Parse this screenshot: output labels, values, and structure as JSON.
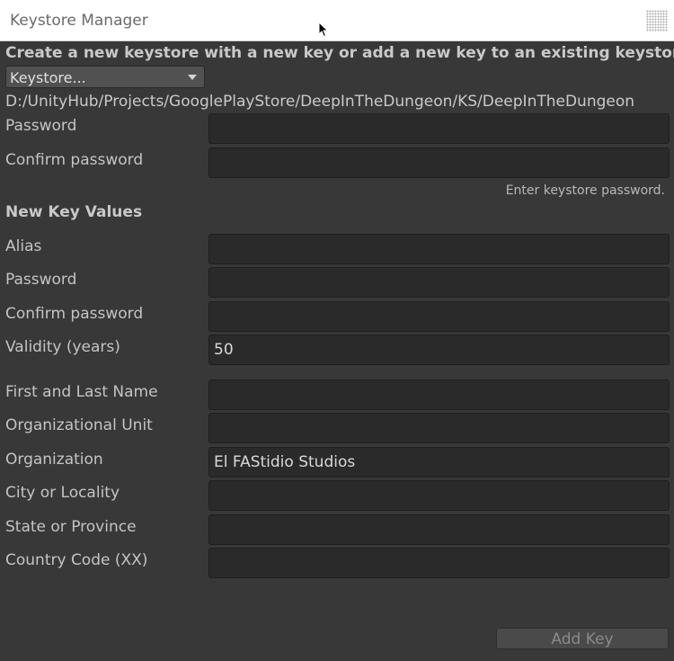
{
  "window": {
    "title": "Keystore Manager"
  },
  "heading": "Create a new keystore with a new key or add a new key to an existing keystore",
  "keystore_dropdown": {
    "selected": "Keystore..."
  },
  "keystore_path": "D:/UnityHub/Projects/GooglePlayStore/DeepInTheDungeon/KS/DeepInTheDungeon",
  "keystore": {
    "password_label": "Password",
    "password_value": "",
    "confirm_label": "Confirm password",
    "confirm_value": "",
    "hint": "Enter keystore password."
  },
  "new_key": {
    "section_title": "New Key Values",
    "alias_label": "Alias",
    "alias_value": "",
    "password_label": "Password",
    "password_value": "",
    "confirm_label": "Confirm password",
    "confirm_value": "",
    "validity_label": "Validity (years)",
    "validity_value": "50",
    "name_label": "First and Last Name",
    "name_value": "",
    "org_unit_label": "Organizational Unit",
    "org_unit_value": "",
    "org_label": "Organization",
    "org_value": "El FAStidio Studios",
    "city_label": "City or Locality",
    "city_value": "",
    "state_label": "State or Province",
    "state_value": "",
    "country_label": "Country Code (XX)",
    "country_value": ""
  },
  "add_key_button": "Add Key",
  "icons": {
    "resize_grip": "resize-grip-icon",
    "cursor": "mouse-cursor-icon",
    "dropdown": "chevron-down-icon"
  }
}
